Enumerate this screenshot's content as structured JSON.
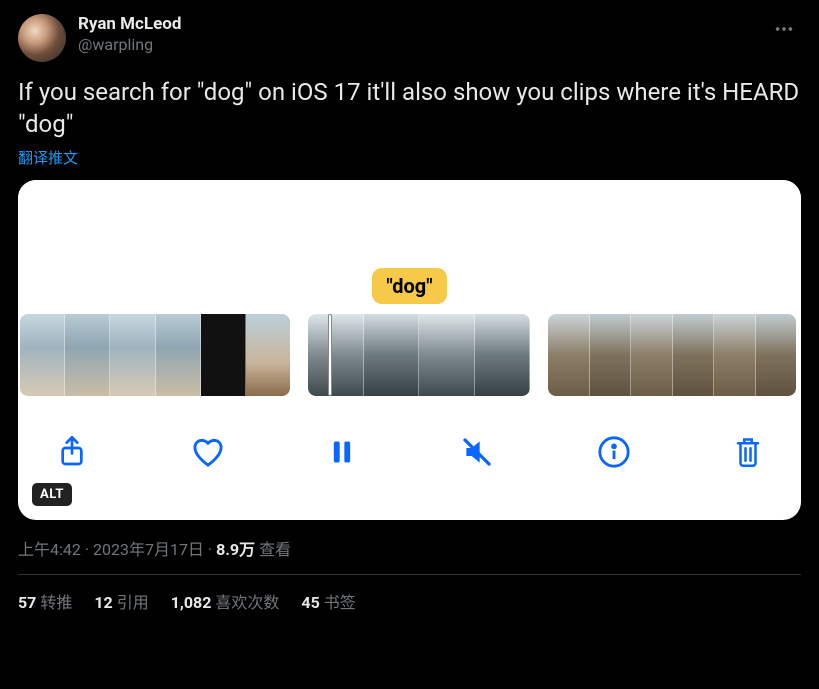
{
  "author": {
    "display_name": "Ryan McLeod",
    "handle": "@warpling"
  },
  "tweet_text": "If you search for \"dog\" on iOS 17 it'll also show you clips where it's HEARD \"dog\"",
  "translate_label": "翻译推文",
  "media": {
    "highlight_label": "\"dog\"",
    "alt_badge": "ALT"
  },
  "meta": {
    "time": "上午4:42",
    "sep1": " · ",
    "date": "2023年7月17日",
    "sep2": " · ",
    "views_num": "8.9万",
    "views_label": " 查看"
  },
  "stats": {
    "retweets_num": "57",
    "retweets_label": "转推",
    "quotes_num": "12",
    "quotes_label": "引用",
    "likes_num": "1,082",
    "likes_label": "喜欢次数",
    "bookmarks_num": "45",
    "bookmarks_label": "书签"
  }
}
